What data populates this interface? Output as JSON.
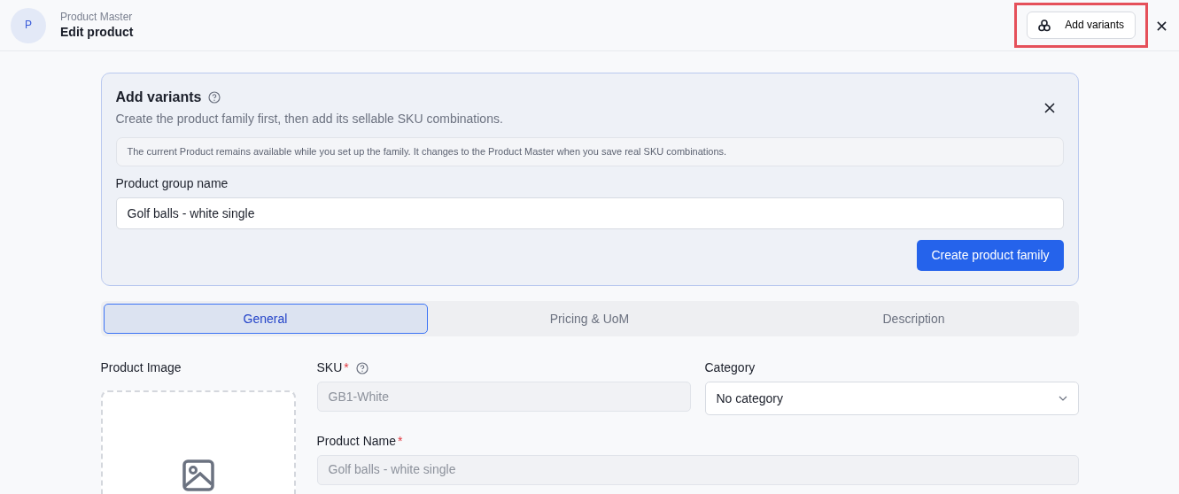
{
  "header": {
    "avatar": "P",
    "subtitle": "Product Master",
    "title": "Edit product",
    "action": {
      "label": "Add variants",
      "highlighted": true
    }
  },
  "variant_panel": {
    "title": "Add variants",
    "description": "Create the product family first, then add its sellable SKU combinations.",
    "notice": "The current Product remains available while you set up the family. It changes to the Product Master when you save real SKU combinations.",
    "field": {
      "label": "Product group name",
      "value": "Golf balls - white single"
    },
    "button": "Create product family"
  },
  "tabs": [
    {
      "label": "General",
      "selected": true
    },
    {
      "label": "Pricing & UoM",
      "selected": false
    },
    {
      "label": "Description",
      "selected": false
    }
  ],
  "form": {
    "image_label": "Product Image",
    "fields": [
      {
        "kind": "input",
        "label": "SKU",
        "required_mark": "*",
        "help": true,
        "value": "GB1-White",
        "disabled": true
      },
      {
        "kind": "select",
        "label": "Category",
        "help": false,
        "value": "No category",
        "disabled": false
      },
      {
        "kind": "input",
        "label": "Product Name",
        "required_mark": "*",
        "help": false,
        "value": "Golf balls - white single",
        "disabled": true
      }
    ]
  }
}
